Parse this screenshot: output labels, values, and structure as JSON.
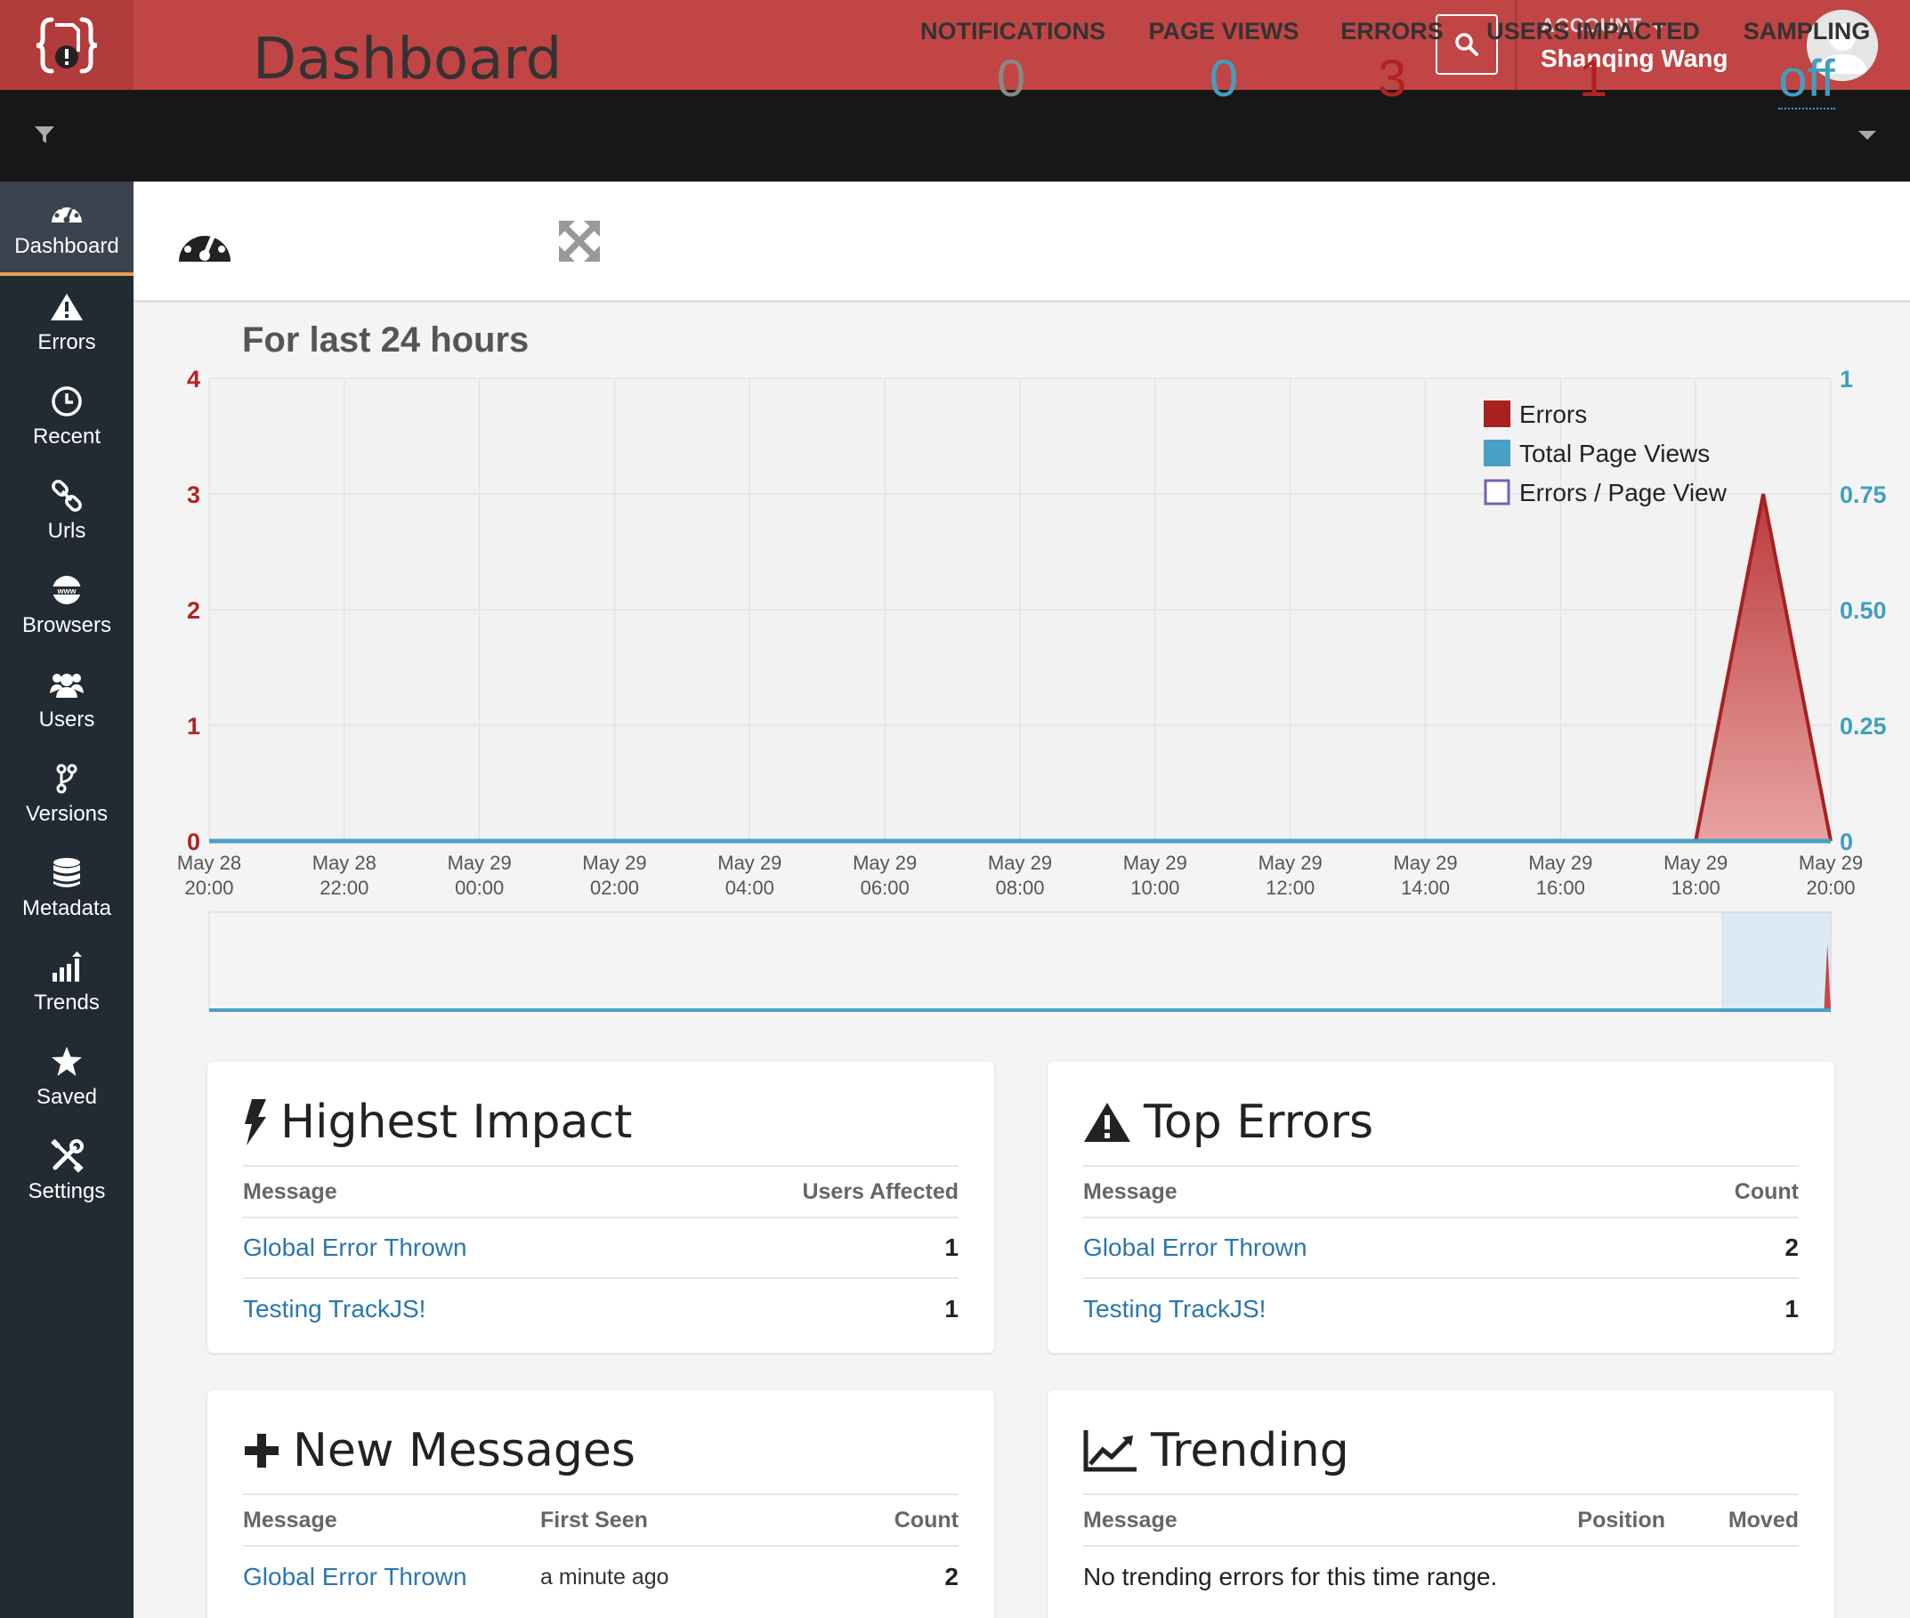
{
  "topbar": {
    "account_label": "ACCOUNT",
    "user_name": "Shanqing Wang"
  },
  "sidebar": {
    "items": [
      {
        "label": "Dashboard",
        "icon": "gauge-icon",
        "active": true
      },
      {
        "label": "Errors",
        "icon": "warning-icon"
      },
      {
        "label": "Recent",
        "icon": "clock-icon"
      },
      {
        "label": "Urls",
        "icon": "link-icon"
      },
      {
        "label": "Browsers",
        "icon": "globe-www-icon"
      },
      {
        "label": "Users",
        "icon": "users-icon"
      },
      {
        "label": "Versions",
        "icon": "branch-icon"
      },
      {
        "label": "Metadata",
        "icon": "database-icon"
      },
      {
        "label": "Trends",
        "icon": "bar-chart-icon"
      },
      {
        "label": "Saved",
        "icon": "star-icon"
      },
      {
        "label": "Settings",
        "icon": "tools-icon"
      }
    ]
  },
  "header": {
    "title": "Dashboard",
    "stats": [
      {
        "label": "NOTIFICATIONS",
        "value": "0",
        "color": "#888888"
      },
      {
        "label": "PAGE VIEWS",
        "value": "0",
        "color": "#3f9fbf"
      },
      {
        "label": "ERRORS",
        "value": "3",
        "color": "#b22222"
      },
      {
        "label": "USERS IMPACTED",
        "value": "1",
        "color": "#b22222"
      },
      {
        "label": "SAMPLING",
        "value": "off",
        "color": "#3f9fbf"
      }
    ]
  },
  "chart_caption": "For last 24 hours",
  "chart_data": {
    "type": "area",
    "x": [
      "May 28 20:00",
      "May 28 22:00",
      "May 29 00:00",
      "May 29 02:00",
      "May 29 04:00",
      "May 29 06:00",
      "May 29 08:00",
      "May 29 10:00",
      "May 29 12:00",
      "May 29 14:00",
      "May 29 16:00",
      "May 29 18:00",
      "May 29 20:00"
    ],
    "x_ticks": [
      {
        "line1": "May 28",
        "line2": "20:00"
      },
      {
        "line1": "May 28",
        "line2": "22:00"
      },
      {
        "line1": "May 29",
        "line2": "00:00"
      },
      {
        "line1": "May 29",
        "line2": "02:00"
      },
      {
        "line1": "May 29",
        "line2": "04:00"
      },
      {
        "line1": "May 29",
        "line2": "06:00"
      },
      {
        "line1": "May 29",
        "line2": "08:00"
      },
      {
        "line1": "May 29",
        "line2": "10:00"
      },
      {
        "line1": "May 29",
        "line2": "12:00"
      },
      {
        "line1": "May 29",
        "line2": "14:00"
      },
      {
        "line1": "May 29",
        "line2": "16:00"
      },
      {
        "line1": "May 29",
        "line2": "18:00"
      },
      {
        "line1": "May 29",
        "line2": "20:00"
      }
    ],
    "x_range_hours": [
      0,
      24
    ],
    "y_left_ticks": [
      "0",
      "1",
      "2",
      "3",
      "4"
    ],
    "y_left_lim": [
      0,
      4
    ],
    "y_right_ticks": [
      "0",
      "0.25",
      "0.50",
      "0.75",
      "1"
    ],
    "y_right_lim": [
      0,
      1
    ],
    "series": [
      {
        "name": "Errors",
        "axis": "left",
        "color": "#a82020",
        "points": [
          [
            0,
            0
          ],
          [
            22,
            0
          ],
          [
            23,
            3
          ],
          [
            24,
            0
          ]
        ]
      },
      {
        "name": "Total Page Views",
        "axis": "right",
        "color": "#4a9fc4",
        "points": [
          [
            0,
            0
          ],
          [
            24,
            0
          ]
        ]
      },
      {
        "name": "Errors / Page View",
        "axis": "right",
        "color": "#7a5fb0",
        "points": []
      }
    ],
    "legend_position": "top-right",
    "grid": true,
    "navigator_window_hours": [
      22,
      24
    ]
  },
  "highest_impact": {
    "title": "Highest Impact",
    "col_message": "Message",
    "col_users": "Users Affected",
    "rows": [
      {
        "message": "Global Error Thrown",
        "value": "1"
      },
      {
        "message": "Testing TrackJS!",
        "value": "1"
      }
    ]
  },
  "top_errors": {
    "title": "Top Errors",
    "col_message": "Message",
    "col_count": "Count",
    "rows": [
      {
        "message": "Global Error Thrown",
        "value": "2"
      },
      {
        "message": "Testing TrackJS!",
        "value": "1"
      }
    ]
  },
  "new_messages": {
    "title": "New Messages",
    "col_message": "Message",
    "col_first_seen": "First Seen",
    "col_count": "Count",
    "rows": [
      {
        "message": "Global Error Thrown",
        "first_seen": "a minute ago",
        "value": "2"
      }
    ]
  },
  "trending": {
    "title": "Trending",
    "col_message": "Message",
    "col_position": "Position",
    "col_moved": "Moved",
    "empty_text": "No trending errors for this time range."
  }
}
